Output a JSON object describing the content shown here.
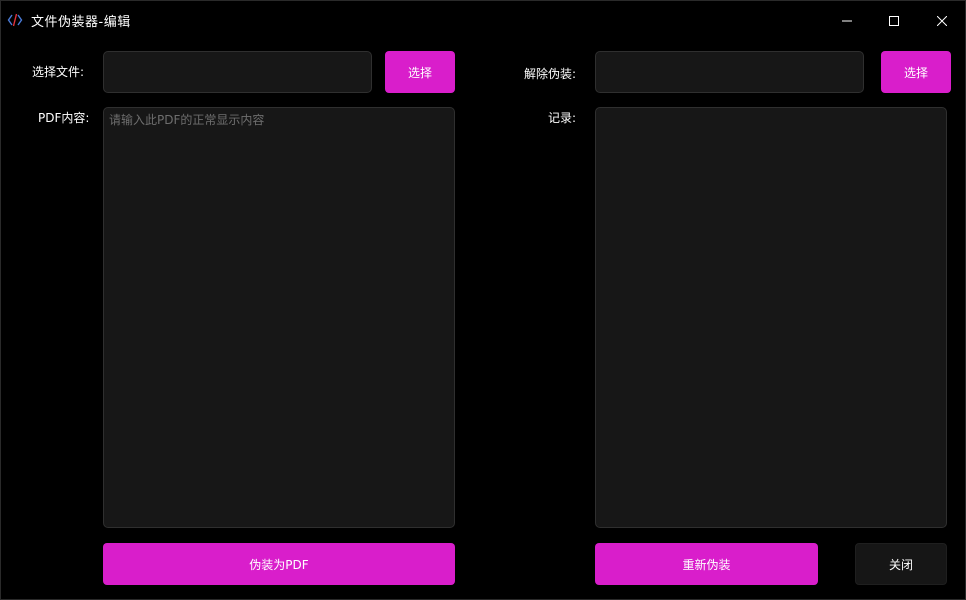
{
  "window": {
    "title": "文件伪装器-编辑",
    "icon": "code-brackets-icon",
    "controls": [
      "minimize-icon",
      "maximize-icon",
      "close-icon"
    ]
  },
  "left": {
    "select_file_label": "选择文件:",
    "select_file_value": "",
    "select_button": "选择",
    "pdf_content_label": "PDF内容:",
    "pdf_content_placeholder": "请输入此PDF的正常显示内容",
    "disguise_button": "伪装为PDF"
  },
  "right": {
    "undisguise_label": "解除伪装:",
    "undisguise_value": "",
    "select_button": "选择",
    "log_label": "记录:",
    "log_content": "",
    "redisguise_button": "重新伪装",
    "close_button": "关闭"
  },
  "colors": {
    "accent": "#d91ecb",
    "background": "#000000",
    "field": "#171717"
  }
}
